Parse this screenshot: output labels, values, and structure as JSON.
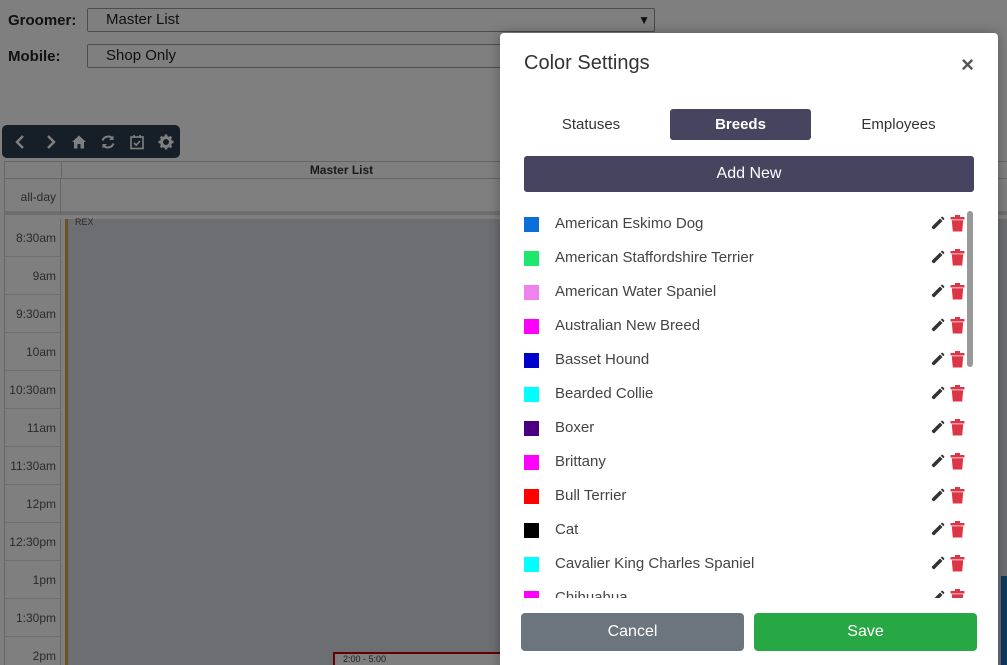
{
  "background": {
    "groomer_label": "Groomer:",
    "groomer_value": "Master List",
    "mobile_label": "Mobile:",
    "mobile_value": "Shop Only",
    "calendar_column": "Master List",
    "allday_label": "all-day",
    "times": [
      "8:30am",
      "9am",
      "9:30am",
      "10am",
      "10:30am",
      "11am",
      "11:30am",
      "12pm",
      "12:30pm",
      "1pm",
      "1:30pm",
      "2pm"
    ],
    "rex_label": "REX",
    "appointment_label": "2:00 - 5:00"
  },
  "modal": {
    "title": "Color Settings",
    "close": "×",
    "tabs": [
      {
        "label": "Statuses",
        "active": false
      },
      {
        "label": "Breeds",
        "active": true
      },
      {
        "label": "Employees",
        "active": false
      }
    ],
    "add_new": "Add New",
    "breeds": [
      {
        "name": "American Eskimo Dog",
        "color": "#0a6fd6"
      },
      {
        "name": "American Staffordshire Terrier",
        "color": "#1de86d"
      },
      {
        "name": "American Water Spaniel",
        "color": "#ee82ee"
      },
      {
        "name": "Australian New Breed",
        "color": "#ff00ff"
      },
      {
        "name": "Basset Hound",
        "color": "#0000cc"
      },
      {
        "name": "Bearded Collie",
        "color": "#00ffff"
      },
      {
        "name": "Boxer",
        "color": "#4b0082"
      },
      {
        "name": "Brittany",
        "color": "#ff00ff"
      },
      {
        "name": "Bull Terrier",
        "color": "#ff0000"
      },
      {
        "name": "Cat",
        "color": "#000000"
      },
      {
        "name": "Cavalier King Charles Spaniel",
        "color": "#00ffff"
      },
      {
        "name": "Chihuahua",
        "color": "#ff00ff"
      }
    ],
    "cancel": "Cancel",
    "save": "Save"
  },
  "colors": {
    "accent": "#474460",
    "save": "#28a745",
    "cancel": "#6c757d",
    "delete": "#dc3545",
    "toolbar": "#2c3e50"
  },
  "icons": {
    "toolbar": [
      "chevron-left-icon",
      "chevron-right-icon",
      "home-icon",
      "refresh-icon",
      "calendar-check-icon",
      "gear-icon"
    ],
    "row_actions": [
      "pencil-icon",
      "trash-icon"
    ]
  }
}
